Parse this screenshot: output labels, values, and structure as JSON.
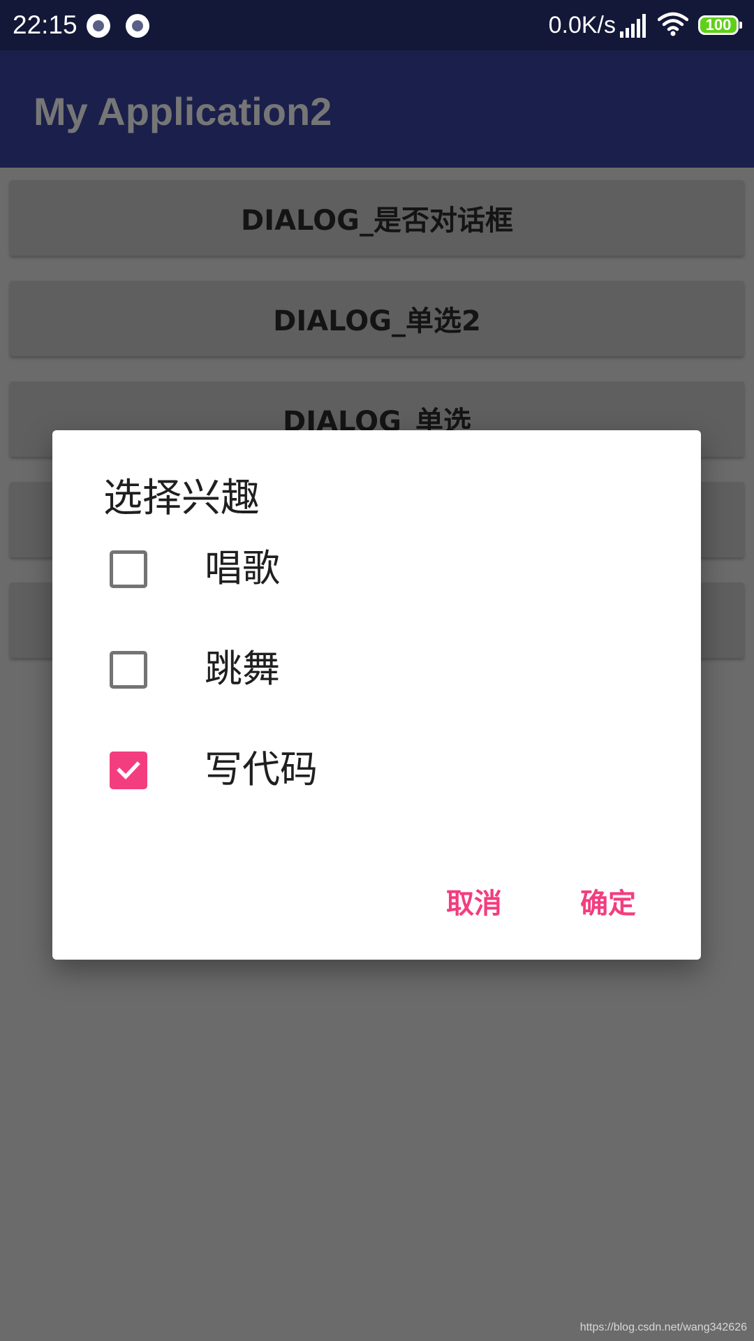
{
  "status_bar": {
    "time": "22:15",
    "net_speed": "0.0K/s",
    "battery": "100",
    "icons": [
      "notification-icon",
      "notification-icon",
      "signal-icon",
      "wifi-icon",
      "battery-icon"
    ]
  },
  "app_bar": {
    "title": "My Application2"
  },
  "buttons": [
    {
      "label": "DIALOG_是否对话框"
    },
    {
      "label": "DIALOG_单选2"
    },
    {
      "label": "DIALOG_单选"
    }
  ],
  "dialog": {
    "title": "选择兴趣",
    "options": [
      {
        "label": "唱歌",
        "checked": false
      },
      {
        "label": "跳舞",
        "checked": false
      },
      {
        "label": "写代码",
        "checked": true
      }
    ],
    "cancel_label": "取消",
    "confirm_label": "确定"
  },
  "colors": {
    "status_bar": "#131838",
    "app_bar": "#1a1f4b",
    "accent": "#f33d7e",
    "scrim_background": "#6b6b6b"
  },
  "watermark": "https://blog.csdn.net/wang342626"
}
